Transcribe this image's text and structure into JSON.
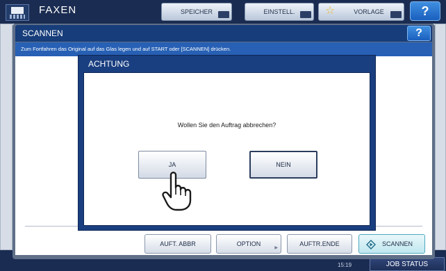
{
  "background": {
    "title": "FAXEN",
    "tabs": [
      {
        "label": "SPEICHER"
      },
      {
        "label": "EINSTELL."
      },
      {
        "label": "VORLAGE"
      }
    ],
    "help_label": "?",
    "time": "15:19",
    "job_status_label": "JOB STATUS"
  },
  "scan_panel": {
    "title": "SCANNEN",
    "help_label": "?",
    "message": "Zum Fortfahren das Original auf das Glas legen und auf START oder [SCANNEN] drücken.",
    "buttons": {
      "abort": "AUFT. ABBR",
      "option": "OPTION",
      "end": "AUFTR.ENDE",
      "scan": "SCANNEN"
    }
  },
  "dialog": {
    "title": "ACHTUNG",
    "message": "Wollen Sie den Auftrag abbrechen?",
    "yes_label": "JA",
    "no_label": "NEIN"
  },
  "colors": {
    "header_dark": "#1b2c52",
    "dialog_blue": "#1a3f80",
    "message_bar": "#2760b4",
    "help_blue": "#1a5fbe",
    "scan_accent": "#4ea8bf"
  },
  "icons": [
    "fax-icon",
    "star-icon",
    "help-icon",
    "start-icon",
    "hand-pointer-icon",
    "dropdown-arrow-icon"
  ]
}
